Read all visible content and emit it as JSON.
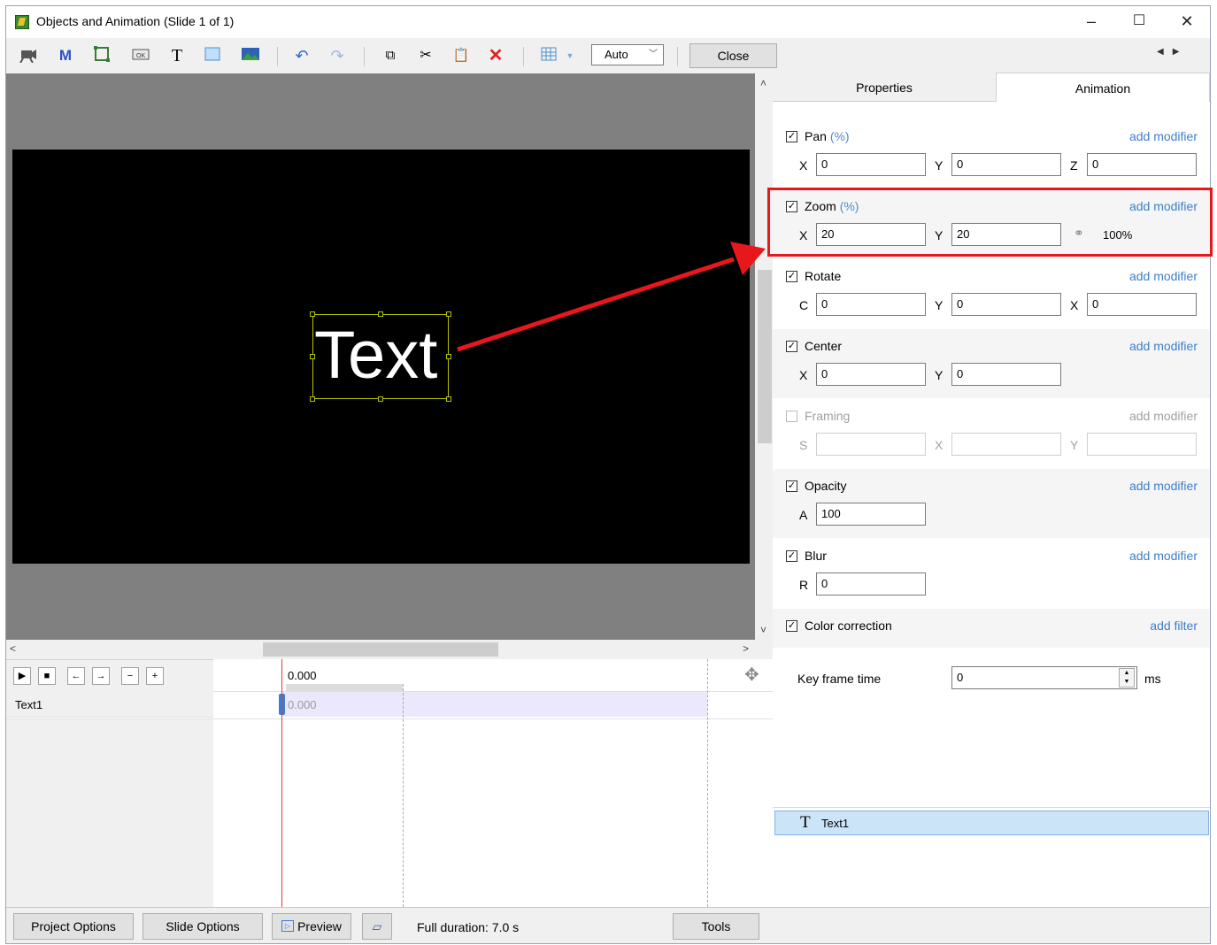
{
  "window": {
    "title": "Objects and Animation (Slide 1 of 1)",
    "minimize": "–",
    "maximize": "☐",
    "close": "✕"
  },
  "toolbar": {
    "zoom_value": "Auto",
    "close_label": "Close",
    "icon_m": "M",
    "icon_t": "T"
  },
  "canvas": {
    "text_object": "Text"
  },
  "timeline": {
    "time_header": "0.000",
    "row_name": "Text1",
    "row_time": "0.000",
    "controls": [
      "▶",
      "■",
      "←",
      "→",
      "−",
      "+"
    ]
  },
  "tabs": {
    "properties": "Properties",
    "animation": "Animation"
  },
  "animation": {
    "pan": {
      "label": "Pan",
      "unit": "(%)",
      "link": "add modifier",
      "x_label": "X",
      "x": "0",
      "y_label": "Y",
      "y": "0",
      "z_label": "Z",
      "z": "0"
    },
    "zoom": {
      "label": "Zoom",
      "unit": "(%)",
      "link": "add modifier",
      "x_label": "X",
      "x": "20",
      "y_label": "Y",
      "y": "20",
      "ratio": "100%"
    },
    "rotate": {
      "label": "Rotate",
      "link": "add modifier",
      "c_label": "C",
      "c": "0",
      "y_label": "Y",
      "y": "0",
      "x_label": "X",
      "x": "0"
    },
    "center": {
      "label": "Center",
      "link": "add modifier",
      "x_label": "X",
      "x": "0",
      "y_label": "Y",
      "y": "0"
    },
    "framing": {
      "label": "Framing",
      "link": "add modifier",
      "s_label": "S",
      "x_label": "X",
      "y_label": "Y"
    },
    "opacity": {
      "label": "Opacity",
      "link": "add modifier",
      "a_label": "A",
      "a": "100"
    },
    "blur": {
      "label": "Blur",
      "link": "add modifier",
      "r_label": "R",
      "r": "0"
    },
    "color": {
      "label": "Color correction",
      "link": "add filter"
    },
    "keyframe": {
      "label": "Key frame time",
      "value": "0",
      "unit": "ms"
    }
  },
  "objects_list": [
    {
      "icon": "T",
      "name": "Text1"
    }
  ],
  "footer": {
    "project_options": "Project Options",
    "slide_options": "Slide Options",
    "preview": "Preview",
    "duration": "Full duration: 7.0 s",
    "tools": "Tools"
  },
  "colors": {
    "highlight_box": "#e8171b",
    "link": "#3e7fc8",
    "selection_handles": "#b5c400",
    "playhead": "#e23c3c"
  }
}
